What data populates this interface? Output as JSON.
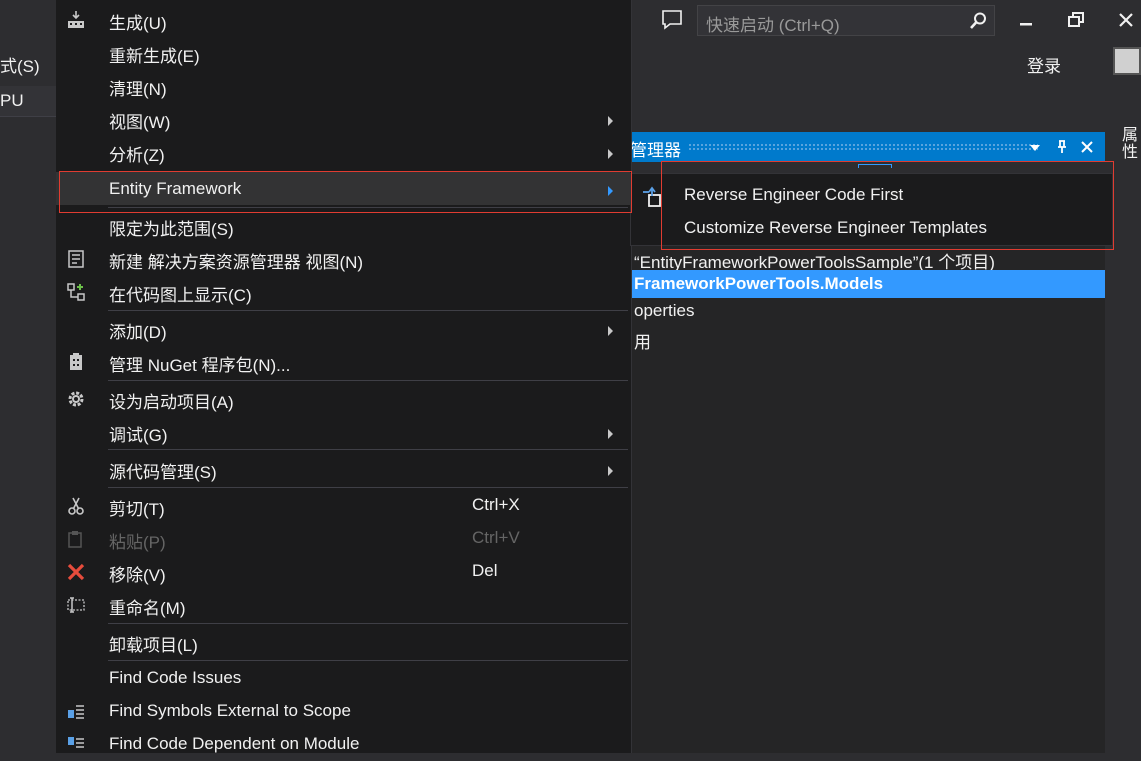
{
  "topbar": {
    "left_menu_fragment": "式(S)",
    "left_platform_fragment": "PU",
    "quick_launch_placeholder": "快速启动 (Ctrl+Q)",
    "login_label": "登录"
  },
  "right_strip": {
    "label": "属性"
  },
  "solution_explorer": {
    "title": "管理器",
    "lines": [
      "“EntityFrameworkPowerToolsSample”(1 个项目)",
      "FrameworkPowerTools.Models",
      "operties",
      "用"
    ]
  },
  "context_menu": {
    "items": [
      {
        "label": "生成(U)"
      },
      {
        "label": "重新生成(E)"
      },
      {
        "label": "清理(N)"
      },
      {
        "label": "视图(W)"
      },
      {
        "label": "分析(Z)"
      },
      {
        "label": "Entity Framework"
      },
      {
        "label": "限定为此范围(S)"
      },
      {
        "label": "新建 解决方案资源管理器 视图(N)"
      },
      {
        "label": "在代码图上显示(C)"
      },
      {
        "label": "添加(D)"
      },
      {
        "label": "管理 NuGet 程序包(N)..."
      },
      {
        "label": "设为启动项目(A)"
      },
      {
        "label": "调试(G)"
      },
      {
        "label": "源代码管理(S)"
      },
      {
        "label": "剪切(T)",
        "shortcut": "Ctrl+X"
      },
      {
        "label": "粘贴(P)",
        "shortcut": "Ctrl+V"
      },
      {
        "label": "移除(V)",
        "shortcut": "Del"
      },
      {
        "label": "重命名(M)"
      },
      {
        "label": "卸载项目(L)"
      },
      {
        "label": "Find Code Issues"
      },
      {
        "label": "Find Symbols External to Scope"
      },
      {
        "label": "Find Code Dependent on Module"
      }
    ]
  },
  "submenu": {
    "items": [
      {
        "label": "Reverse Engineer Code First"
      },
      {
        "label": "Customize Reverse Engineer Templates"
      }
    ]
  },
  "colors": {
    "accent": "#007acc",
    "selection": "#3399ff",
    "highlight_box": "#e03c31",
    "menu_bg": "#1b1b1c"
  }
}
